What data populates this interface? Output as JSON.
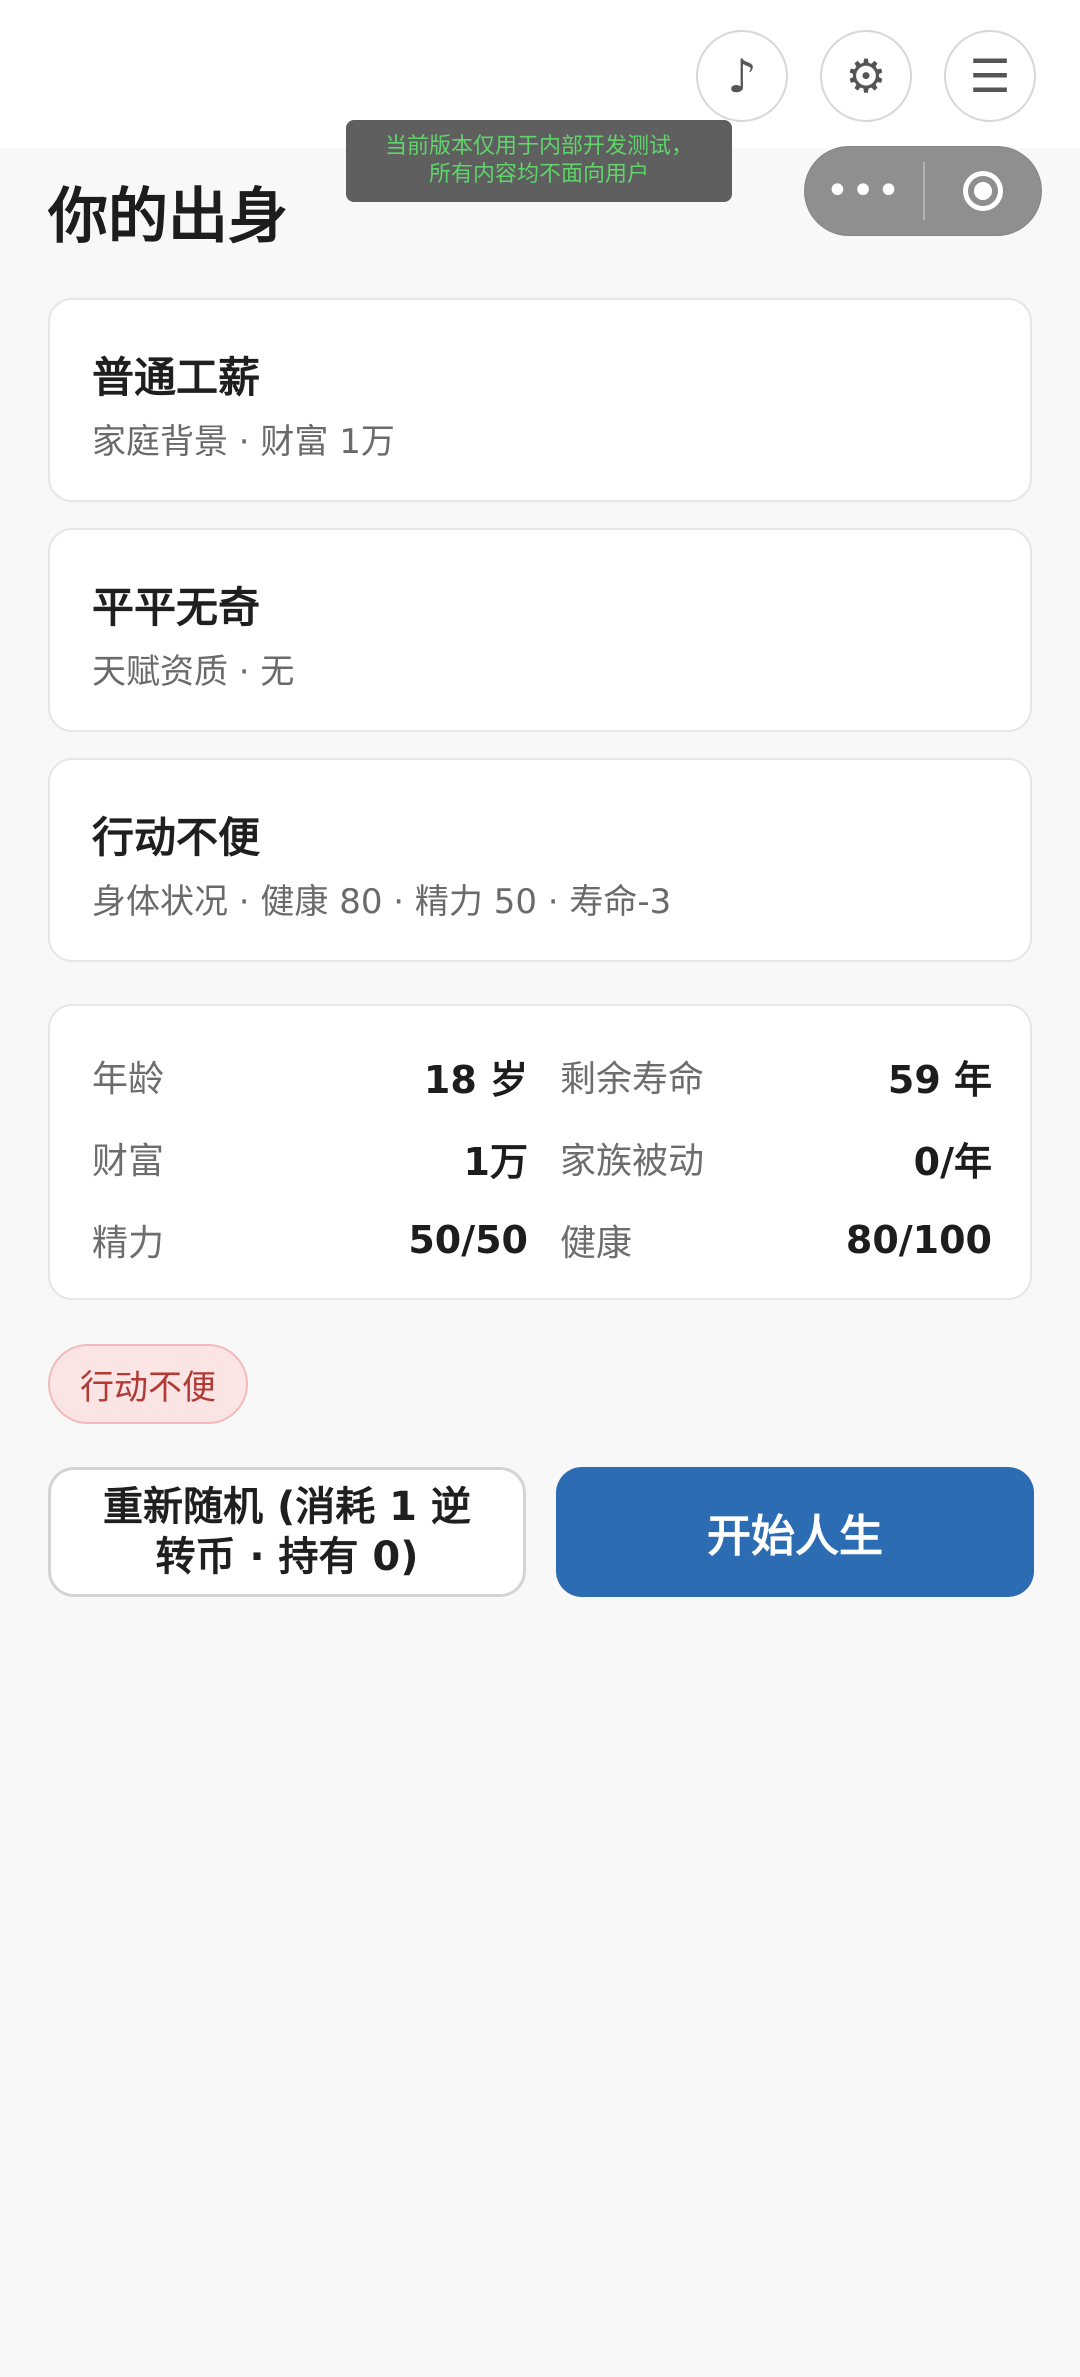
{
  "topbar": {
    "music_icon": "♪",
    "settings_icon": "⚙",
    "menu_icon": "☰"
  },
  "dev_banner": {
    "line1": "当前版本仅用于内部开发测试，",
    "line2": "所有内容均不面向用户"
  },
  "capsule": {
    "more_icon": "•••"
  },
  "page": {
    "title": "你的出身"
  },
  "origins": [
    {
      "title": "普通工薪",
      "subtitle": "家庭背景 · 财富 1万"
    },
    {
      "title": "平平无奇",
      "subtitle": "天赋资质 · 无"
    },
    {
      "title": "行动不便",
      "subtitle": "身体状况 · 健康 80 · 精力 50 · 寿命-3"
    }
  ],
  "stats": {
    "age": {
      "label": "年龄",
      "value": "18 岁"
    },
    "remaining_life": {
      "label": "剩余寿命",
      "value": "59 年"
    },
    "wealth": {
      "label": "财富",
      "value": "1万"
    },
    "family_passive": {
      "label": "家族被动",
      "value": "0/年"
    },
    "energy": {
      "label": "精力",
      "value": "50/50"
    },
    "health": {
      "label": "健康",
      "value": "80/100"
    }
  },
  "tags": [
    "行动不便"
  ],
  "actions": {
    "reroll_label": "重新随机 (消耗 1 逆转币 · 持有 0)",
    "start_label": "开始人生"
  },
  "colors": {
    "primary": "#2c6cb3",
    "tag_bg": "#fbe4e4",
    "tag_text": "#b23a35",
    "banner_text": "#5fd46a"
  }
}
